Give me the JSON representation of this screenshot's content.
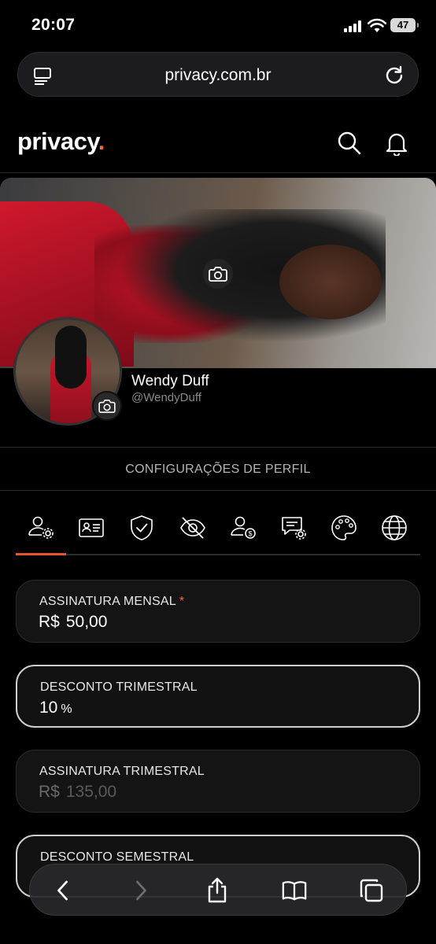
{
  "status": {
    "time": "20:07",
    "battery": "47"
  },
  "browser": {
    "url": "privacy.com.br"
  },
  "app": {
    "logo": "privacy",
    "logo_dot": "."
  },
  "profile": {
    "name": "Wendy Duff",
    "handle": "@WendyDuff"
  },
  "settings": {
    "title": "CONFIGURAÇÕES DE PERFIL",
    "tabs": [
      "user-settings-icon",
      "id-card-icon",
      "shield-check-icon",
      "eye-off-icon",
      "user-money-icon",
      "chat-settings-icon",
      "palette-icon",
      "globe-icon"
    ],
    "active_tab": 0
  },
  "form": {
    "monthly": {
      "label": "ASSINATURA MENSAL",
      "required": "*",
      "currency": "R$",
      "value": "50,00"
    },
    "quarterly_discount": {
      "label": "DESCONTO TRIMESTRAL",
      "value": "10",
      "suffix": "%"
    },
    "quarterly": {
      "label": "ASSINATURA TRIMESTRAL",
      "currency": "R$",
      "value": "135,00"
    },
    "semester_discount": {
      "label": "DESCONTO SEMESTRAL"
    }
  },
  "colors": {
    "accent": "#e8542f",
    "background": "#000000",
    "field_bg": "#141414"
  }
}
